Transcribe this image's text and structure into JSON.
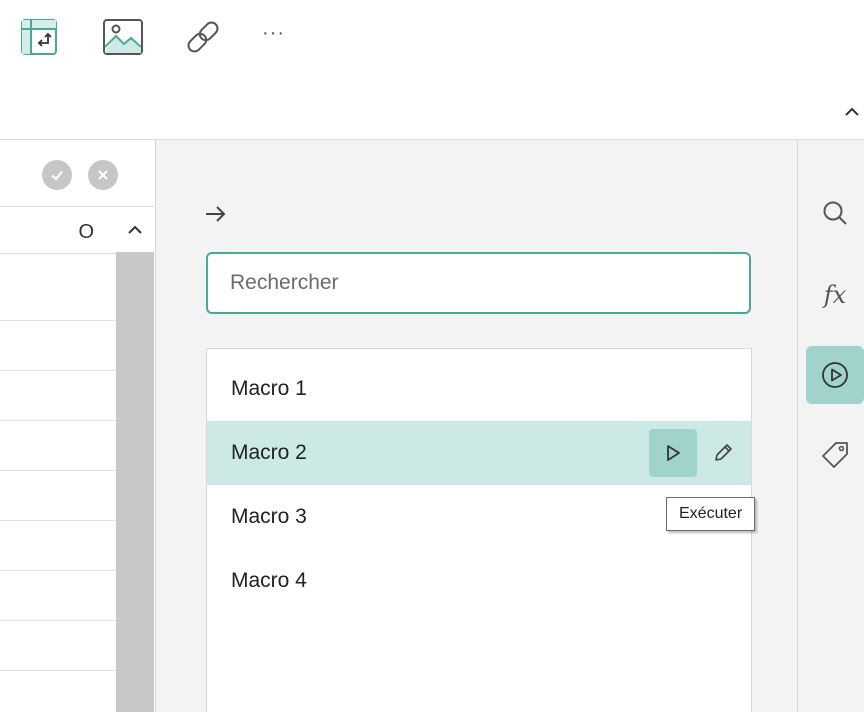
{
  "toolbar": {
    "items": [
      {
        "icon": "pivot-table-icon"
      },
      {
        "icon": "image-chart-icon"
      },
      {
        "icon": "link-icon"
      }
    ],
    "more_label": "···",
    "collapse_icon": "chevron-up-icon"
  },
  "sheet": {
    "column_letter": "O",
    "confirm_icon": "check-circle-icon",
    "cancel_icon": "close-circle-icon"
  },
  "macros": {
    "back_icon": "arrow-right-icon",
    "search_placeholder": "Rechercher",
    "items": [
      {
        "label": "Macro 1"
      },
      {
        "label": "Macro 2",
        "selected": true
      },
      {
        "label": "Macro 3"
      },
      {
        "label": "Macro 4"
      }
    ],
    "run_icon": "play-icon",
    "edit_icon": "pencil-icon",
    "tooltip": "Exécuter"
  },
  "rail": {
    "items": [
      {
        "icon": "search-icon"
      },
      {
        "icon": "function-icon",
        "label": "fx"
      },
      {
        "icon": "macro-play-icon",
        "active": true
      },
      {
        "icon": "tag-icon"
      }
    ]
  },
  "colors": {
    "accent": "#4aa89a",
    "selection": "#cde9e5",
    "active_button": "#9fd3cb",
    "panel_bg": "#f3f3f3"
  }
}
